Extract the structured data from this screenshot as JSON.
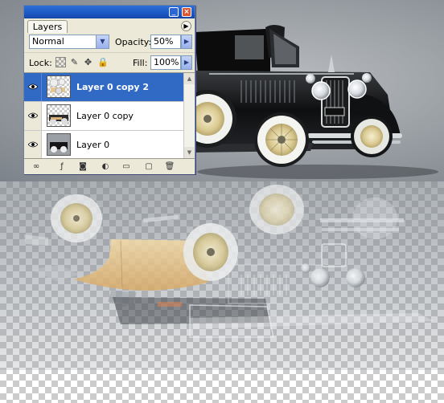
{
  "panel": {
    "title_tab": "Layers",
    "blend_mode": "Normal",
    "opacity_label": "Opacity:",
    "opacity_value": "50%",
    "lock_label": "Lock:",
    "fill_label": "Fill:",
    "fill_value": "100%",
    "layers": [
      {
        "name": "Layer 0 copy 2",
        "selected": true,
        "visible": true
      },
      {
        "name": "Layer 0 copy",
        "selected": false,
        "visible": true
      },
      {
        "name": "Layer 0",
        "selected": false,
        "visible": true
      }
    ],
    "footer_icons": [
      "link-layers-icon",
      "layer-style-icon",
      "layer-mask-icon",
      "adjustment-layer-icon",
      "new-group-icon",
      "new-layer-icon",
      "delete-layer-icon"
    ]
  },
  "icons": {
    "minimize": "_",
    "close": "×",
    "panel_menu": "▶",
    "dropdown": "▼",
    "slider_arrow": "▶",
    "scroll_up": "▲",
    "scroll_down": "▼",
    "lock_brush": "✎",
    "lock_move": "✥",
    "lock_all": "🔒",
    "footer": [
      "∞",
      "ƒ",
      "◙",
      "◐",
      "▭",
      "▢",
      "🗑"
    ]
  },
  "colors": {
    "titlebar": "#1c57c3",
    "selection": "#316ac5",
    "panel_bg": "#ece9d8",
    "car_body": "#111111",
    "tyre_wall": "#f2f2ee",
    "wheel_spokes": "#e8dcae",
    "reflection_tan": "#e8c78e"
  }
}
